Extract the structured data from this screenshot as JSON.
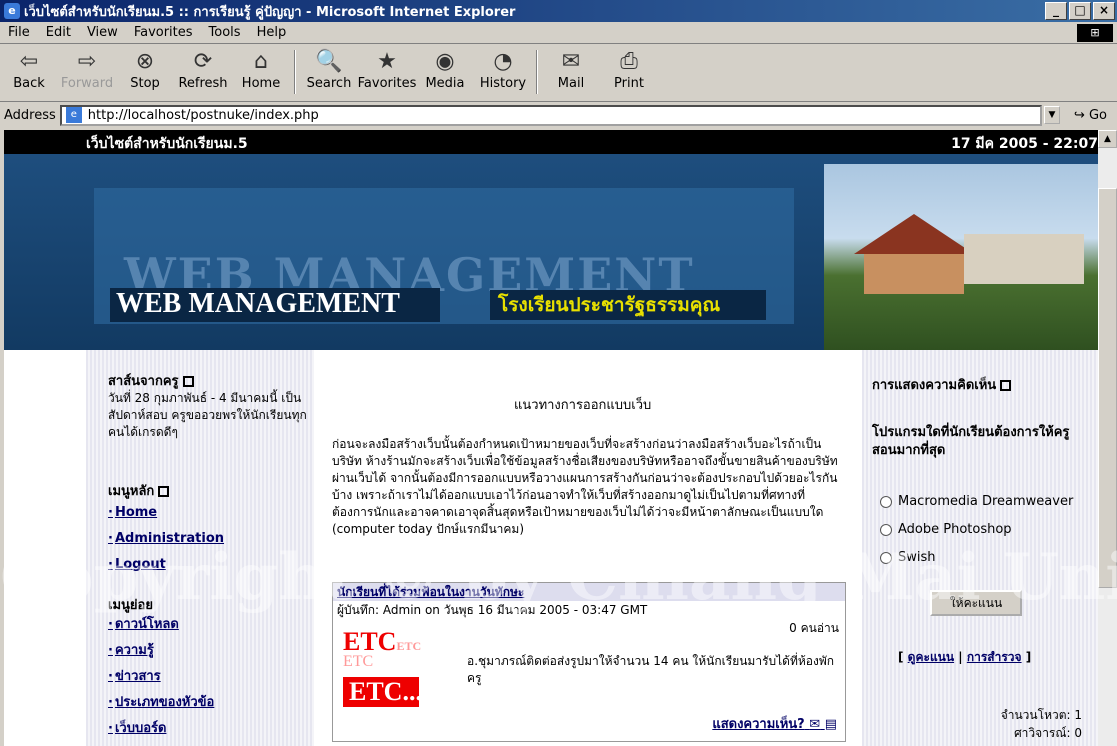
{
  "window": {
    "title": "เว็บไซต์สำหรับนักเรียนม.5 :: การเรียนรู้ คู่ปัญญา - Microsoft Internet Explorer",
    "min": "_",
    "max": "□",
    "close": "×"
  },
  "menubar": [
    "File",
    "Edit",
    "View",
    "Favorites",
    "Tools",
    "Help"
  ],
  "toolbar": [
    {
      "label": "Back",
      "icon": "back-icon",
      "glyph": "⇦"
    },
    {
      "label": "Forward",
      "icon": "forward-icon",
      "glyph": "⇨"
    },
    {
      "label": "Stop",
      "icon": "stop-icon",
      "glyph": "⊗"
    },
    {
      "label": "Refresh",
      "icon": "refresh-icon",
      "glyph": "⟳"
    },
    {
      "label": "Home",
      "icon": "home-icon",
      "glyph": "⌂"
    },
    {
      "label": "Search",
      "icon": "search-icon",
      "glyph": "🔍"
    },
    {
      "label": "Favorites",
      "icon": "favorites-icon",
      "glyph": "★"
    },
    {
      "label": "Media",
      "icon": "media-icon",
      "glyph": "◉"
    },
    {
      "label": "History",
      "icon": "history-icon",
      "glyph": "◔"
    },
    {
      "label": "Mail",
      "icon": "mail-icon",
      "glyph": "✉"
    },
    {
      "label": "Print",
      "icon": "print-icon",
      "glyph": "⎙"
    }
  ],
  "address": {
    "label": "Address",
    "url": "http://localhost/postnuke/index.php",
    "go": "Go"
  },
  "site": {
    "top_left": "เว็บไซต์สำหรับนักเรียนม.5",
    "top_right": "17 มีค 2005 - 22:07",
    "banner_watermark": "WEB MANAGEMENT",
    "banner_title": "WEB MANAGEMENT",
    "banner_school": "โรงเรียนประชารัฐธรรมคุณ"
  },
  "left": {
    "msg_title": "สาส์นจากครู",
    "msg_text": "วันที่ 28 กุมภาพันธ์ - 4 มีนาคมนี้ เป็นสัปดาห์สอบ ครูขออวยพรให้นักเรียนทุกคนได้เกรดดีๆ",
    "main_title": "เมนูหลัก",
    "main_items": [
      "Home",
      "Administration",
      "Logout"
    ],
    "sub_title": "เมนูย่อย",
    "sub_items": [
      "ดาวน์โหลด",
      "ความรู้",
      "ข่าวสาร",
      "ประเภทของหัวข้อ",
      "เว็บบอร์ด"
    ]
  },
  "center": {
    "article_title": "แนวทางการออกแบบเว็บ",
    "article_body": "ก่อนจะลงมือสร้างเว็บนั้นต้องกำหนดเป้าหมายของเว็บที่จะสร้างก่อนว่าลงมือสร้างเว็บอะไรถ้าเป็นบริษัท ห้างร้านมักจะสร้างเว็บเพื่อใช้ข้อมูลสร้างชื่อเสียงของบริษัทหรืออาจถึงขั้นขายสินค้าของบริษัทผ่านเว็บได้ จากนั้นต้องมีการออกแบบหรือวางแผนการสร้างกันก่อนว่าจะต้องประกอบไปด้วยอะไรกันบ้าง เพราะถ้าเราไม่ได้ออกแบบเอาไว้ก่อนอาจทำให้เว็บที่สร้างออกมาดูไม่เป็นไปตามที่ศทางที่ต้องการนักและอาจคาดเอาจุดสิ้นสุดหรือเป้าหมายของเว็บไม่ได้ว่าจะมีหน้าตาลักษณะเป็นแบบใด (computer today ปักษ์แรกมีนาคม)",
    "news_title": "นักเรียนที่ได้ร่วมฟ้อนในงานวันทักษะ",
    "news_by": "ผู้บันทึก: Admin on วันพุธ 16 มีนาคม 2005 - 03:47 GMT",
    "news_reads": "0 คนอ่าน",
    "news_text": "อ.ชุมาภรณ์ติดต่อส่งรูปมาให้จำนวน 14 คน ให้นักเรียนมารับได้ที่ห้องพักครู",
    "news_more": "แสดงความเห็น?",
    "logo_a": "ETC",
    "logo_a_small": "ETC",
    "logo_b": "ETC",
    "logo_c": "ETC..."
  },
  "right": {
    "title": "การแสดงความคิดเห็น",
    "question": "โปรแกรมใดที่นักเรียนต้องการให้ครูสอนมากที่สุด",
    "options": [
      "Macromedia Dreamweaver",
      "Adobe Photoshop",
      "Swish"
    ],
    "vote": "ให้คะแนน",
    "link_results": "ดูคะแนน",
    "link_polls": "การสำรวจ",
    "votes_label": "จำนวนโหวต: 1",
    "comments_label": "ศาวิจารณ์: 0"
  },
  "watermark": "Copyright © by Chiang Mai University"
}
